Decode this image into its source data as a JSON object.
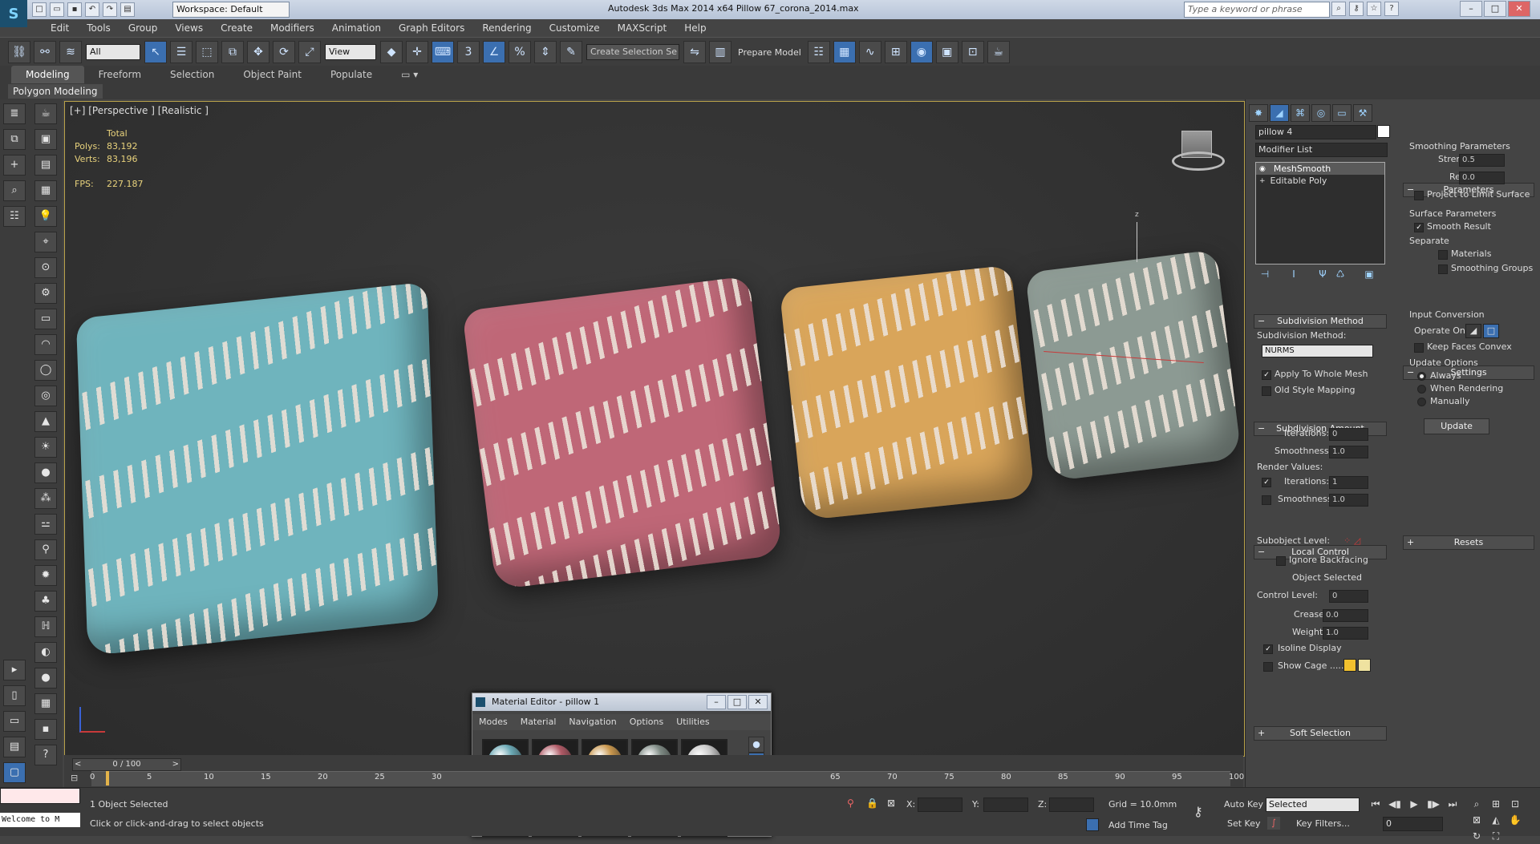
{
  "titlebar": {
    "workspace": "Workspace: Default",
    "title": "Autodesk 3ds Max  2014 x64     Pillow 67_corona_2014.max",
    "search_placeholder": "Type a keyword or phrase"
  },
  "menubar": [
    "Edit",
    "Tools",
    "Group",
    "Views",
    "Create",
    "Modifiers",
    "Animation",
    "Graph Editors",
    "Rendering",
    "Customize",
    "MAXScript",
    "Help"
  ],
  "toolbar": {
    "selection_filter": "All",
    "ref_coord": "View",
    "named_selection": "Create Selection Se",
    "prepare_model": "Prepare Model"
  },
  "ribbon": {
    "tabs": [
      "Modeling",
      "Freeform",
      "Selection",
      "Object Paint",
      "Populate"
    ],
    "active": "Modeling",
    "panel": "Polygon Modeling"
  },
  "viewport": {
    "label": "[+] [Perspective ] [Realistic ]",
    "stats": {
      "total_label": "Total",
      "polys_label": "Polys:",
      "polys": "83,192",
      "verts_label": "Verts:",
      "verts": "83,196"
    },
    "fps_label": "FPS:",
    "fps": "227.187",
    "axis_z": "z",
    "pillow_colors": [
      "#6fb4bd",
      "#bf6777",
      "#d9a55a",
      "#8c9a93"
    ]
  },
  "material_editor": {
    "title": "Material Editor - pillow 1",
    "menu": [
      "Modes",
      "Material",
      "Navigation",
      "Options",
      "Utilities"
    ],
    "ball_colors": [
      "#6aa8b4",
      "#b05a66",
      "#c9974d",
      "#7e8a84",
      "#c8c8c8",
      "#c8c8c8",
      "#c8c8c8",
      "#c8c8c8",
      "#c8c8c8",
      "#c8c8c8"
    ]
  },
  "command_panel": {
    "object_name": "pillow 4",
    "modifier_list": "Modifier List",
    "stack": [
      "MeshSmooth",
      "Editable Poly"
    ],
    "subdivision_method": {
      "header": "Subdivision Method",
      "label": "Subdivision Method:",
      "value": "NURMS",
      "apply_whole_mesh": "Apply To Whole Mesh",
      "old_style": "Old Style Mapping"
    },
    "subdivision_amount": {
      "header": "Subdivision Amount",
      "iterations_label": "Iterations:",
      "iterations": "0",
      "smoothness_label": "Smoothness:",
      "smoothness": "1.0",
      "render_values": "Render Values:",
      "render_iterations_label": "Iterations:",
      "render_iterations": "1",
      "render_smoothness_label": "Smoothness:",
      "render_smoothness": "1.0"
    },
    "local_control": {
      "header": "Local Control",
      "subobject_level": "Subobject Level:",
      "ignore_backfacing": "Ignore Backfacing",
      "object_selected": "Object Selected",
      "control_level_label": "Control Level:",
      "control_level": "0",
      "crease_label": "Crease:",
      "crease": "0.0",
      "weight_label": "Weight:",
      "weight": "1.0",
      "isoline": "Isoline Display",
      "show_cage": "Show Cage ......"
    },
    "soft_selection": "Soft Selection",
    "parameters": {
      "header": "Parameters",
      "smoothing_params": "Smoothing Parameters",
      "strength_label": "Strength:",
      "strength": "0.5",
      "relax_label": "Relax:",
      "relax": "0.0",
      "project_limit": "Project to Limit Surface",
      "surface_params": "Surface Parameters",
      "smooth_result": "Smooth Result",
      "separate": "Separate",
      "materials": "Materials",
      "smoothing_groups": "Smoothing Groups"
    },
    "settings": {
      "header": "Settings",
      "input_conversion": "Input Conversion",
      "operate_on": "Operate On:",
      "keep_faces_convex": "Keep Faces Convex",
      "update_options": "Update Options",
      "always": "Always",
      "when_rendering": "When Rendering",
      "manually": "Manually",
      "update_btn": "Update"
    },
    "resets": "Resets"
  },
  "timeline": {
    "frame": "0 / 100",
    "ticks": [
      "0",
      "5",
      "10",
      "15",
      "20",
      "25",
      "30",
      "65",
      "70",
      "75",
      "80",
      "85",
      "90",
      "95",
      "100"
    ]
  },
  "status": {
    "maxscript": "Welcome to M",
    "selected": "1 Object Selected",
    "prompt": "Click or click-and-drag to select objects",
    "x_label": "X:",
    "y_label": "Y:",
    "z_label": "Z:",
    "grid": "Grid = 10.0mm",
    "add_time_tag": "Add Time Tag",
    "auto_key": "Auto Key",
    "set_key": "Set Key",
    "key_mode": "Selected",
    "key_filters": "Key Filters...",
    "current_frame": "0"
  }
}
